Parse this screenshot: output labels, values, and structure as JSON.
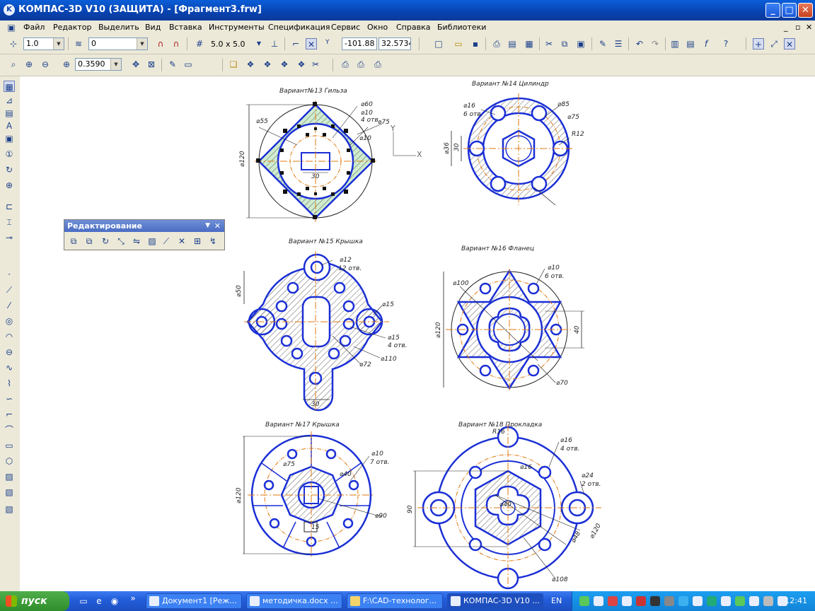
{
  "window": {
    "title": "КОМПАС-3D V10 (ЗАЩИТА) - [Фрагмент3.frw]",
    "minimize": "_",
    "maximize": "□",
    "close": "✕"
  },
  "menu": [
    "Файл",
    "Редактор",
    "Выделить",
    "Вид",
    "Вставка",
    "Инструменты",
    "Спецификация",
    "Сервис",
    "Окно",
    "Справка",
    "Библиотеки"
  ],
  "mdi_controls": [
    "_",
    "▫",
    "✕"
  ],
  "toolbar1": {
    "step": "1.0",
    "layer": "0",
    "grid": "5.0 x 5.0",
    "coord_x": "-101.88",
    "coord_y": "32.5734"
  },
  "toolbar2": {
    "zoom": "0.3590"
  },
  "palette": {
    "title": "Редактирование"
  },
  "drawings": {
    "v13": {
      "title": "Вариант№13  Гильза",
      "d60": "⌀60",
      "d10": "⌀10",
      "n4": "4 отв.",
      "d75": "⌀75",
      "d55": "⌀55",
      "d120": "⌀120",
      "w30": "30",
      "d10b": "⌀10"
    },
    "v14": {
      "title": "Вариант №14  Цилиндр",
      "d16": "⌀16",
      "n6": "6 отв.",
      "d85": "⌀85",
      "d75": "⌀75",
      "r12": "R12",
      "d36": "⌀36",
      "w30": "30"
    },
    "v15": {
      "title": "Вариант №15 Крышка",
      "d12": "⌀12",
      "n12": "12 отв.",
      "d50": "⌀50",
      "d15": "⌀15",
      "d15b": "⌀15",
      "n4": "4 отв.",
      "d110": "⌀110",
      "d72": "⌀72",
      "w30": "30"
    },
    "v16": {
      "title": "Вариант №16   Фланец",
      "d10": "⌀10",
      "n6": "6 отв.",
      "d100": "⌀100",
      "d120": "⌀120",
      "w40": "40",
      "d70": "⌀70"
    },
    "v17": {
      "title": "Вариант №17    Крышка",
      "d10": "⌀10",
      "n7": "7 отв.",
      "d75": "⌀75",
      "d40": "⌀40",
      "d120": "⌀120",
      "d90": "⌀90",
      "d15": "15"
    },
    "v18": {
      "title": "Вариант №18   Прокладка",
      "r16": "R16",
      "d16": "⌀16",
      "n4": "4 отв.",
      "d16b": "⌀16",
      "d24": "⌀24",
      "n2": "2 отв.",
      "w90": "90",
      "d120": "⌀120",
      "d40": "⌀40",
      "d48": "⌀48",
      "d108": "⌀108"
    }
  },
  "axes": {
    "y": "Y",
    "x": "X"
  },
  "taskbar": {
    "start": "пуск",
    "tasks": [
      "Документ1 [Реж...",
      "методичка.docx ...",
      "F:\\CAD-технолог...",
      "КОМПАС-3D V10 ..."
    ],
    "lang": "EN",
    "clock": "12:41"
  }
}
